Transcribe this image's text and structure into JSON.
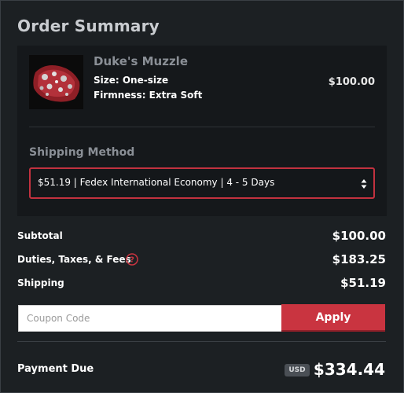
{
  "header": {
    "title": "Order Summary"
  },
  "product": {
    "name": "Duke's Muzzle",
    "size": "Size: One-size",
    "firmness": "Firmness: Extra Soft",
    "price": "$100.00",
    "image_icon": "product-image"
  },
  "shipping": {
    "heading": "Shipping Method",
    "selected": "$51.19 | Fedex International Economy | 4 - 5 Days"
  },
  "totals": {
    "subtotal_label": "Subtotal",
    "subtotal_value": "$100.00",
    "duties_label": "Duties, Taxes, & Fees",
    "duties_value": "$183.25",
    "shipping_label": "Shipping",
    "shipping_value": "$51.19"
  },
  "coupon": {
    "placeholder": "Coupon Code",
    "value": "",
    "apply_label": "Apply"
  },
  "payment": {
    "label": "Payment Due",
    "currency": "USD",
    "amount": "$334.44"
  },
  "colors": {
    "accent": "#c93440",
    "background": "#1c2023",
    "panel": "#15181b"
  }
}
